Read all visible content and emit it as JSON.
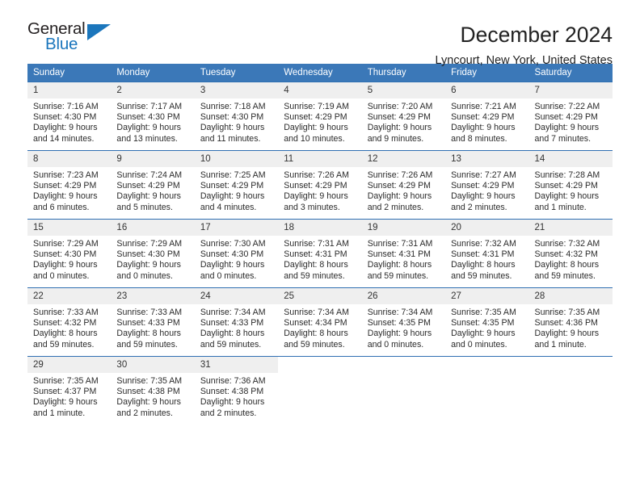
{
  "brand": {
    "word_one": "General",
    "word_two": "Blue",
    "triangle_icon": "triangle-icon",
    "accent_color": "#1b76bc"
  },
  "header": {
    "month_title": "December 2024",
    "location": "Lyncourt, New York, United States",
    "header_bg_color": "#3b78b8",
    "row_border_color": "#2f6fb2",
    "daynum_bg_color": "#efefef"
  },
  "calendar": {
    "day_headers": [
      "Sunday",
      "Monday",
      "Tuesday",
      "Wednesday",
      "Thursday",
      "Friday",
      "Saturday"
    ],
    "weeks": [
      [
        {
          "day": "1",
          "sunrise": "Sunrise: 7:16 AM",
          "sunset": "Sunset: 4:30 PM",
          "daylight_line1": "Daylight: 9 hours",
          "daylight_line2": "and 14 minutes."
        },
        {
          "day": "2",
          "sunrise": "Sunrise: 7:17 AM",
          "sunset": "Sunset: 4:30 PM",
          "daylight_line1": "Daylight: 9 hours",
          "daylight_line2": "and 13 minutes."
        },
        {
          "day": "3",
          "sunrise": "Sunrise: 7:18 AM",
          "sunset": "Sunset: 4:30 PM",
          "daylight_line1": "Daylight: 9 hours",
          "daylight_line2": "and 11 minutes."
        },
        {
          "day": "4",
          "sunrise": "Sunrise: 7:19 AM",
          "sunset": "Sunset: 4:29 PM",
          "daylight_line1": "Daylight: 9 hours",
          "daylight_line2": "and 10 minutes."
        },
        {
          "day": "5",
          "sunrise": "Sunrise: 7:20 AM",
          "sunset": "Sunset: 4:29 PM",
          "daylight_line1": "Daylight: 9 hours",
          "daylight_line2": "and 9 minutes."
        },
        {
          "day": "6",
          "sunrise": "Sunrise: 7:21 AM",
          "sunset": "Sunset: 4:29 PM",
          "daylight_line1": "Daylight: 9 hours",
          "daylight_line2": "and 8 minutes."
        },
        {
          "day": "7",
          "sunrise": "Sunrise: 7:22 AM",
          "sunset": "Sunset: 4:29 PM",
          "daylight_line1": "Daylight: 9 hours",
          "daylight_line2": "and 7 minutes."
        }
      ],
      [
        {
          "day": "8",
          "sunrise": "Sunrise: 7:23 AM",
          "sunset": "Sunset: 4:29 PM",
          "daylight_line1": "Daylight: 9 hours",
          "daylight_line2": "and 6 minutes."
        },
        {
          "day": "9",
          "sunrise": "Sunrise: 7:24 AM",
          "sunset": "Sunset: 4:29 PM",
          "daylight_line1": "Daylight: 9 hours",
          "daylight_line2": "and 5 minutes."
        },
        {
          "day": "10",
          "sunrise": "Sunrise: 7:25 AM",
          "sunset": "Sunset: 4:29 PM",
          "daylight_line1": "Daylight: 9 hours",
          "daylight_line2": "and 4 minutes."
        },
        {
          "day": "11",
          "sunrise": "Sunrise: 7:26 AM",
          "sunset": "Sunset: 4:29 PM",
          "daylight_line1": "Daylight: 9 hours",
          "daylight_line2": "and 3 minutes."
        },
        {
          "day": "12",
          "sunrise": "Sunrise: 7:26 AM",
          "sunset": "Sunset: 4:29 PM",
          "daylight_line1": "Daylight: 9 hours",
          "daylight_line2": "and 2 minutes."
        },
        {
          "day": "13",
          "sunrise": "Sunrise: 7:27 AM",
          "sunset": "Sunset: 4:29 PM",
          "daylight_line1": "Daylight: 9 hours",
          "daylight_line2": "and 2 minutes."
        },
        {
          "day": "14",
          "sunrise": "Sunrise: 7:28 AM",
          "sunset": "Sunset: 4:29 PM",
          "daylight_line1": "Daylight: 9 hours",
          "daylight_line2": "and 1 minute."
        }
      ],
      [
        {
          "day": "15",
          "sunrise": "Sunrise: 7:29 AM",
          "sunset": "Sunset: 4:30 PM",
          "daylight_line1": "Daylight: 9 hours",
          "daylight_line2": "and 0 minutes."
        },
        {
          "day": "16",
          "sunrise": "Sunrise: 7:29 AM",
          "sunset": "Sunset: 4:30 PM",
          "daylight_line1": "Daylight: 9 hours",
          "daylight_line2": "and 0 minutes."
        },
        {
          "day": "17",
          "sunrise": "Sunrise: 7:30 AM",
          "sunset": "Sunset: 4:30 PM",
          "daylight_line1": "Daylight: 9 hours",
          "daylight_line2": "and 0 minutes."
        },
        {
          "day": "18",
          "sunrise": "Sunrise: 7:31 AM",
          "sunset": "Sunset: 4:31 PM",
          "daylight_line1": "Daylight: 8 hours",
          "daylight_line2": "and 59 minutes."
        },
        {
          "day": "19",
          "sunrise": "Sunrise: 7:31 AM",
          "sunset": "Sunset: 4:31 PM",
          "daylight_line1": "Daylight: 8 hours",
          "daylight_line2": "and 59 minutes."
        },
        {
          "day": "20",
          "sunrise": "Sunrise: 7:32 AM",
          "sunset": "Sunset: 4:31 PM",
          "daylight_line1": "Daylight: 8 hours",
          "daylight_line2": "and 59 minutes."
        },
        {
          "day": "21",
          "sunrise": "Sunrise: 7:32 AM",
          "sunset": "Sunset: 4:32 PM",
          "daylight_line1": "Daylight: 8 hours",
          "daylight_line2": "and 59 minutes."
        }
      ],
      [
        {
          "day": "22",
          "sunrise": "Sunrise: 7:33 AM",
          "sunset": "Sunset: 4:32 PM",
          "daylight_line1": "Daylight: 8 hours",
          "daylight_line2": "and 59 minutes."
        },
        {
          "day": "23",
          "sunrise": "Sunrise: 7:33 AM",
          "sunset": "Sunset: 4:33 PM",
          "daylight_line1": "Daylight: 8 hours",
          "daylight_line2": "and 59 minutes."
        },
        {
          "day": "24",
          "sunrise": "Sunrise: 7:34 AM",
          "sunset": "Sunset: 4:33 PM",
          "daylight_line1": "Daylight: 8 hours",
          "daylight_line2": "and 59 minutes."
        },
        {
          "day": "25",
          "sunrise": "Sunrise: 7:34 AM",
          "sunset": "Sunset: 4:34 PM",
          "daylight_line1": "Daylight: 8 hours",
          "daylight_line2": "and 59 minutes."
        },
        {
          "day": "26",
          "sunrise": "Sunrise: 7:34 AM",
          "sunset": "Sunset: 4:35 PM",
          "daylight_line1": "Daylight: 9 hours",
          "daylight_line2": "and 0 minutes."
        },
        {
          "day": "27",
          "sunrise": "Sunrise: 7:35 AM",
          "sunset": "Sunset: 4:35 PM",
          "daylight_line1": "Daylight: 9 hours",
          "daylight_line2": "and 0 minutes."
        },
        {
          "day": "28",
          "sunrise": "Sunrise: 7:35 AM",
          "sunset": "Sunset: 4:36 PM",
          "daylight_line1": "Daylight: 9 hours",
          "daylight_line2": "and 1 minute."
        }
      ],
      [
        {
          "day": "29",
          "sunrise": "Sunrise: 7:35 AM",
          "sunset": "Sunset: 4:37 PM",
          "daylight_line1": "Daylight: 9 hours",
          "daylight_line2": "and 1 minute."
        },
        {
          "day": "30",
          "sunrise": "Sunrise: 7:35 AM",
          "sunset": "Sunset: 4:38 PM",
          "daylight_line1": "Daylight: 9 hours",
          "daylight_line2": "and 2 minutes."
        },
        {
          "day": "31",
          "sunrise": "Sunrise: 7:36 AM",
          "sunset": "Sunset: 4:38 PM",
          "daylight_line1": "Daylight: 9 hours",
          "daylight_line2": "and 2 minutes."
        },
        {
          "day": "",
          "sunrise": "",
          "sunset": "",
          "daylight_line1": "",
          "daylight_line2": ""
        },
        {
          "day": "",
          "sunrise": "",
          "sunset": "",
          "daylight_line1": "",
          "daylight_line2": ""
        },
        {
          "day": "",
          "sunrise": "",
          "sunset": "",
          "daylight_line1": "",
          "daylight_line2": ""
        },
        {
          "day": "",
          "sunrise": "",
          "sunset": "",
          "daylight_line1": "",
          "daylight_line2": ""
        }
      ]
    ]
  }
}
